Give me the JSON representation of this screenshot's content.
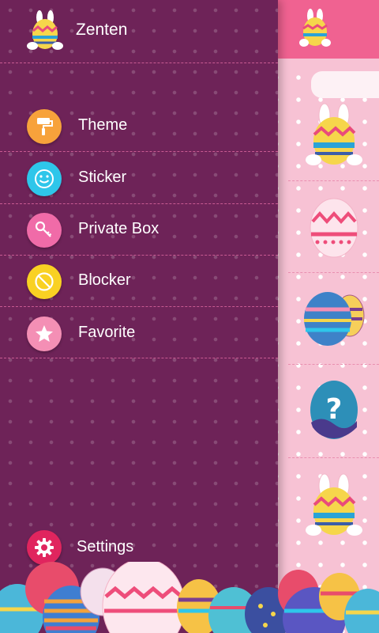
{
  "app": {
    "title": "Zenten",
    "avatar_icon": "bunny-egg-icon"
  },
  "menu": {
    "items": [
      {
        "label": "Theme",
        "icon": "paint-roller-icon",
        "color": "#f7a23b"
      },
      {
        "label": "Sticker",
        "icon": "smiley-icon",
        "color": "#2ec6ea"
      },
      {
        "label": "Private Box",
        "icon": "key-icon",
        "color": "#f06ba8"
      },
      {
        "label": "Blocker",
        "icon": "block-icon",
        "color": "#f9d123"
      },
      {
        "label": "Favorite",
        "icon": "star-icon",
        "color": "#f48fb5"
      }
    ],
    "settings": {
      "label": "Settings",
      "icon": "gear-icon",
      "color": "#e0255e"
    }
  },
  "colors": {
    "drawer_bg": "#6e2358",
    "accent": "#f06291",
    "panel_bg": "#f7c2d4"
  }
}
